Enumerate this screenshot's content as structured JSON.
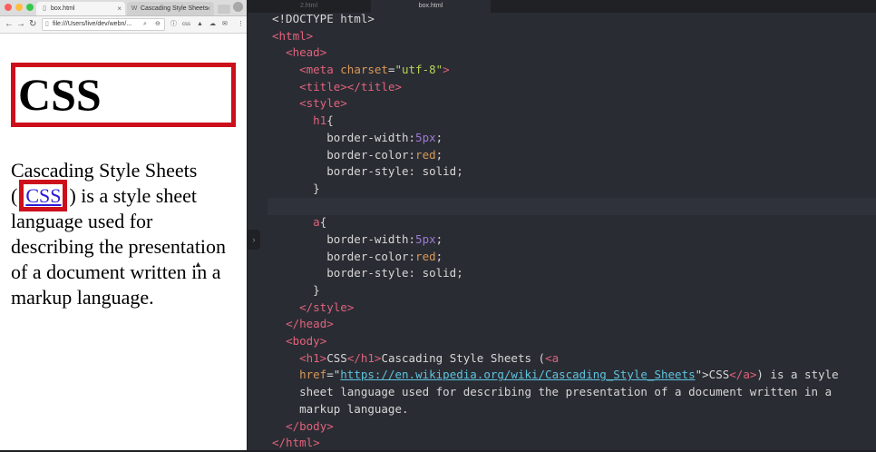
{
  "browser": {
    "tabs": [
      {
        "label": "box.html",
        "active": true
      },
      {
        "label": "Cascading Style Sheets",
        "active": false
      }
    ],
    "address": "file:///Users/live/dev/webn/...",
    "toolbar_icons": [
      "back-icon",
      "forward-icon",
      "reload-icon",
      "search-icon",
      "zoom-icon",
      "info-icon",
      "css-icon",
      "mountain-icon",
      "cloud-icon",
      "mail-icon",
      "menu-icon"
    ],
    "page": {
      "heading": "CSS",
      "paragraph_before": "Cascading Style Sheets (",
      "link_text": "CSS",
      "paragraph_after": ") is a style sheet language used for describing the presentation of a document written in a markup language."
    },
    "colors": {
      "border_red": "#cc0f1b",
      "link_blue": "#2a1bd6"
    }
  },
  "editor": {
    "tabs": [
      {
        "label": "2.html",
        "active": false
      },
      {
        "label": "box.html",
        "active": true
      }
    ],
    "highlighted_line": 12,
    "code_lines": [
      [
        [
          "pl",
          "<!DOCTYPE html>"
        ]
      ],
      [
        [
          "tg",
          "<html>"
        ]
      ],
      [
        [
          "pl",
          "  "
        ],
        [
          "tg",
          "<head>"
        ]
      ],
      [
        [
          "pl",
          "    "
        ],
        [
          "tg",
          "<meta "
        ],
        [
          "at",
          "charset"
        ],
        [
          "pl",
          "="
        ],
        [
          "st",
          "\"utf-8\""
        ],
        [
          "tg",
          ">"
        ]
      ],
      [
        [
          "pl",
          "    "
        ],
        [
          "tg",
          "<title></title>"
        ]
      ],
      [
        [
          "pl",
          "    "
        ],
        [
          "tg",
          "<style>"
        ]
      ],
      [
        [
          "pl",
          "      "
        ],
        [
          "tg",
          "h1"
        ],
        [
          "pl",
          "{"
        ]
      ],
      [
        [
          "pl",
          "        border-width:"
        ],
        [
          "nm",
          "5px"
        ],
        [
          "pl",
          ";"
        ]
      ],
      [
        [
          "pl",
          "        border-color:"
        ],
        [
          "at",
          "red"
        ],
        [
          "pl",
          ";"
        ]
      ],
      [
        [
          "pl",
          "        border-style: solid;"
        ]
      ],
      [
        [
          "pl",
          "      }"
        ]
      ],
      [
        [
          "pl",
          ""
        ]
      ],
      [
        [
          "pl",
          "      "
        ],
        [
          "tg",
          "a"
        ],
        [
          "pl",
          "{"
        ]
      ],
      [
        [
          "pl",
          "        border-width:"
        ],
        [
          "nm",
          "5px"
        ],
        [
          "pl",
          ";"
        ]
      ],
      [
        [
          "pl",
          "        border-color:"
        ],
        [
          "at",
          "red"
        ],
        [
          "pl",
          ";"
        ]
      ],
      [
        [
          "pl",
          "        border-style: solid;"
        ]
      ],
      [
        [
          "pl",
          "      }"
        ]
      ],
      [
        [
          "pl",
          "    "
        ],
        [
          "tg",
          "</style>"
        ]
      ],
      [
        [
          "pl",
          "  "
        ],
        [
          "tg",
          "</head>"
        ]
      ],
      [
        [
          "pl",
          "  "
        ],
        [
          "tg",
          "<body>"
        ]
      ],
      [
        [
          "pl",
          "    "
        ],
        [
          "tg",
          "<h1>"
        ],
        [
          "pl",
          "CSS"
        ],
        [
          "tg",
          "</h1>"
        ],
        [
          "pl",
          "Cascading Style Sheets ("
        ],
        [
          "tg",
          "<a"
        ]
      ],
      [
        [
          "pl",
          "    "
        ],
        [
          "at",
          "href"
        ],
        [
          "pl",
          "=\""
        ],
        [
          "ul",
          "https://en.wikipedia.org/wiki/Cascading_Style_Sheets"
        ],
        [
          "pl",
          "\">CSS"
        ],
        [
          "tg",
          "</a>"
        ],
        [
          "pl",
          ") is a style"
        ]
      ],
      [
        [
          "pl",
          "    sheet language used for describing the presentation of a document written in a"
        ]
      ],
      [
        [
          "pl",
          "    markup language."
        ]
      ],
      [
        [
          "pl",
          "  "
        ],
        [
          "tg",
          "</body>"
        ]
      ],
      [
        [
          "tg",
          "</html>"
        ]
      ]
    ]
  }
}
